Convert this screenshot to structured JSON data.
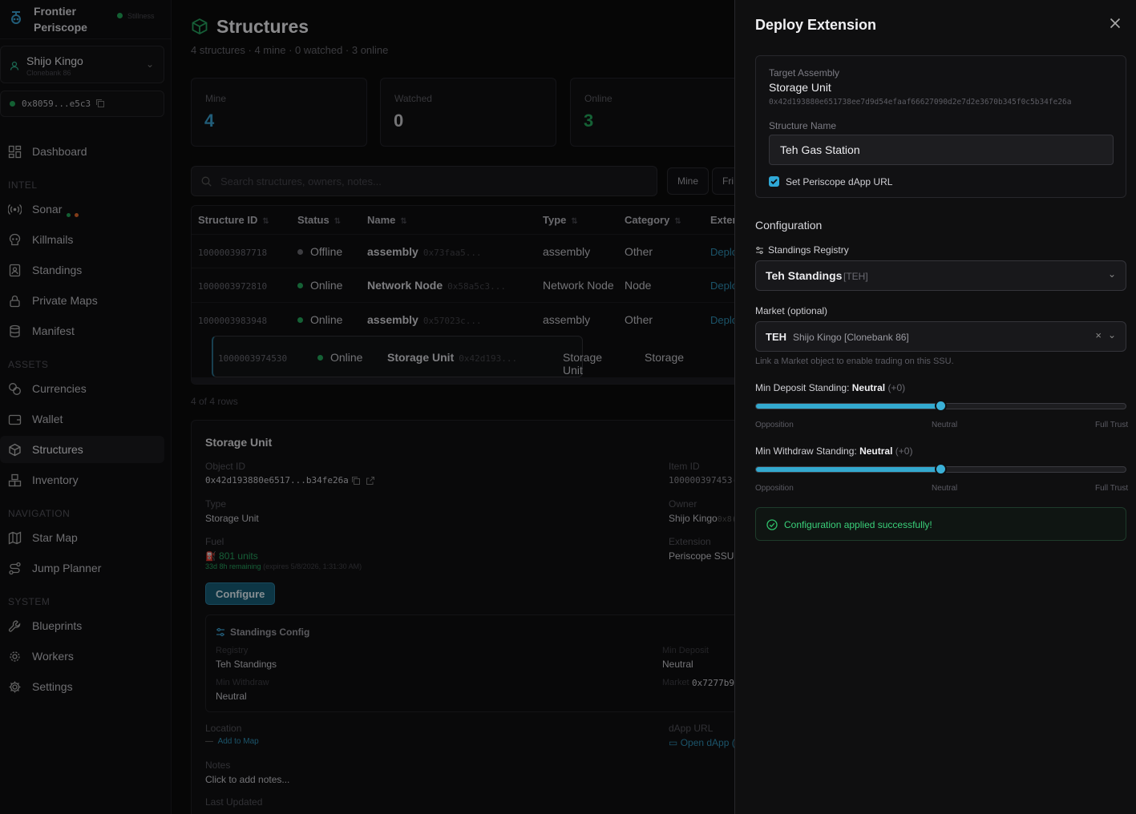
{
  "sidebar": {
    "brand_line1": "Frontier",
    "brand_line2": "Periscope",
    "server_status": "Stillness",
    "user_name": "Shijo Kingo",
    "user_sub": "Clonebank 86",
    "wallet_addr": "0x8059...e5c3",
    "sections": {
      "intel": "INTEL",
      "assets": "ASSETS",
      "navigation": "NAVIGATION",
      "system": "SYSTEM"
    },
    "items": [
      {
        "label": "Dashboard"
      },
      {
        "label": "Sonar"
      },
      {
        "label": "Killmails"
      },
      {
        "label": "Standings"
      },
      {
        "label": "Private Maps"
      },
      {
        "label": "Manifest"
      },
      {
        "label": "Currencies"
      },
      {
        "label": "Wallet"
      },
      {
        "label": "Structures"
      },
      {
        "label": "Inventory"
      },
      {
        "label": "Star Map"
      },
      {
        "label": "Jump Planner"
      },
      {
        "label": "Blueprints"
      },
      {
        "label": "Workers"
      },
      {
        "label": "Settings"
      }
    ]
  },
  "main": {
    "title": "Structures",
    "subtitle": "4 structures · 4 mine · 0 watched · 3 online",
    "cards": [
      {
        "label": "Mine",
        "value": "4",
        "color": "#3aa0d0"
      },
      {
        "label": "Watched",
        "value": "0",
        "color": "#c8c8cc"
      },
      {
        "label": "Online",
        "value": "3",
        "color": "#25a75c"
      }
    ],
    "search_placeholder": "Search structures, owners, notes...",
    "filters": [
      "Mine",
      "Fri"
    ],
    "columns": [
      "Structure ID",
      "Status",
      "Name",
      "Type",
      "Category",
      "Exter"
    ],
    "rows": [
      {
        "id": "1000003987718",
        "status": "Offline",
        "status_color": "#6a6a70",
        "name": "assembly",
        "hash": "0x73faa5...",
        "type": "assembly",
        "category": "Other",
        "ext": "Deplo"
      },
      {
        "id": "1000003972810",
        "status": "Online",
        "status_color": "#25a75c",
        "name": "Network Node",
        "hash": "0x58a5c3...",
        "type": "Network Node",
        "category": "Node",
        "ext": "Deplo"
      },
      {
        "id": "1000003983948",
        "status": "Online",
        "status_color": "#25a75c",
        "name": "assembly",
        "hash": "0x57023c...",
        "type": "assembly",
        "category": "Other",
        "ext": "Deplo"
      },
      {
        "id": "1000003974530",
        "status": "Online",
        "status_color": "#25a75c",
        "name": "Storage Unit",
        "hash": "0x42d193...",
        "type": "Storage Unit",
        "category": "Storage",
        "ext": ""
      }
    ],
    "row_count": "4 of 4 rows",
    "detail": {
      "title": "Storage Unit",
      "object_id_label": "Object ID",
      "object_id": "0x42d193880e6517...b34fe26a",
      "item_id_label": "Item ID",
      "item_id": "100000397453(",
      "type_label": "Type",
      "type": "Storage Unit",
      "owner_label": "Owner",
      "owner": "Shijo Kingo",
      "owner_hash": "0x8(",
      "fuel_label": "Fuel",
      "fuel": "801 units",
      "fuel_remaining": "33d 8h remaining",
      "fuel_expires": "(expires 5/8/2026, 1:31:30 AM)",
      "extension_label": "Extension",
      "extension": "Periscope SSU",
      "configure": "Configure",
      "standings_title": "Standings Config",
      "registry_label": "Registry",
      "registry": "Teh Standings",
      "min_deposit_label": "Min Deposit",
      "min_deposit": "Neutral",
      "min_withdraw_label": "Min Withdraw",
      "min_withdraw": "Neutral",
      "market_label": "Market",
      "market": "0x7277b9",
      "location_label": "Location",
      "add_to_map": "Add to Map",
      "dapp_label": "dApp URL",
      "open_dapp": "Open dApp (",
      "notes_label": "Notes",
      "notes": "Click to add notes...",
      "updated_label": "Last Updated"
    }
  },
  "drawer": {
    "title": "Deploy Extension",
    "target_label": "Target Assembly",
    "target_name": "Storage Unit",
    "target_id": "0x42d193880e651738ee7d9d54efaaf66627090d2e7d2e3670b345f0c5b34fe26a",
    "name_label": "Structure Name",
    "name_value": "Teh Gas Station",
    "set_dapp": "Set Periscope dApp URL",
    "config_title": "Configuration",
    "registry_label": "Standings Registry",
    "registry_value": "Teh Standings",
    "registry_tag": "[TEH]",
    "market_label": "Market (optional)",
    "market_ticker": "TEH",
    "market_value": "Shijo Kingo [Clonebank 86]",
    "market_hint": "Link a Market object to enable trading on this SSU.",
    "deposit_label": "Min Deposit Standing:",
    "deposit_value": "Neutral",
    "deposit_mod": "(+0)",
    "deposit_fraction": 0.5,
    "withdraw_label": "Min Withdraw Standing:",
    "withdraw_value": "Neutral",
    "withdraw_mod": "(+0)",
    "withdraw_fraction": 0.5,
    "ticks": [
      "Opposition",
      "Neutral",
      "Full Trust"
    ],
    "success": "Configuration applied successfully!"
  }
}
